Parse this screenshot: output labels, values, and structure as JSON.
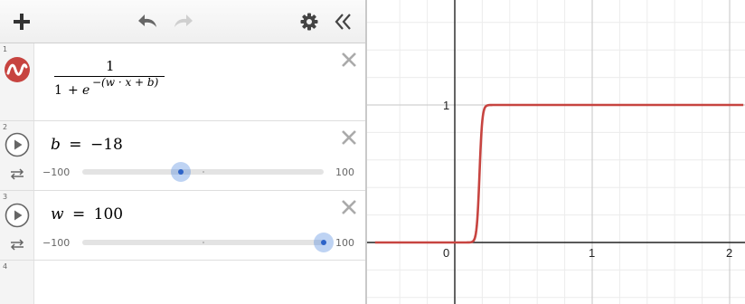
{
  "toolbar": {
    "add_icon": "plus-icon",
    "undo_icon": "undo-icon",
    "redo_icon": "redo-icon",
    "settings_icon": "gear-icon",
    "collapse_icon": "double-chevron-left-icon"
  },
  "expressions": [
    {
      "index": "1",
      "color": "#c74440",
      "icon": "sigmoid-curve-icon",
      "numerator": "1",
      "den_one": "1",
      "den_plus": "+",
      "den_e": "e",
      "exponent": "−(w · x + b)"
    },
    {
      "index": "2",
      "variable": "b",
      "equals": "=",
      "value": "−18",
      "slider_min": "−100",
      "slider_max": "100",
      "fraction": 0.41
    },
    {
      "index": "3",
      "variable": "w",
      "equals": "=",
      "value": "100",
      "slider_min": "−100",
      "slider_max": "100",
      "fraction": 1.0
    },
    {
      "index": "4"
    }
  ],
  "graph": {
    "x_ticks": [
      "0",
      "1",
      "2"
    ],
    "y_ticks": [
      "1"
    ],
    "curve_color": "#c74440",
    "chart_data": {
      "type": "line",
      "function": "1/(1+e^-(w*x+b))",
      "params": {
        "w": 100,
        "b": -18
      },
      "xlim": [
        -0.58,
        2.1
      ],
      "ylim": [
        -0.45,
        1.77
      ],
      "grid": true
    }
  }
}
